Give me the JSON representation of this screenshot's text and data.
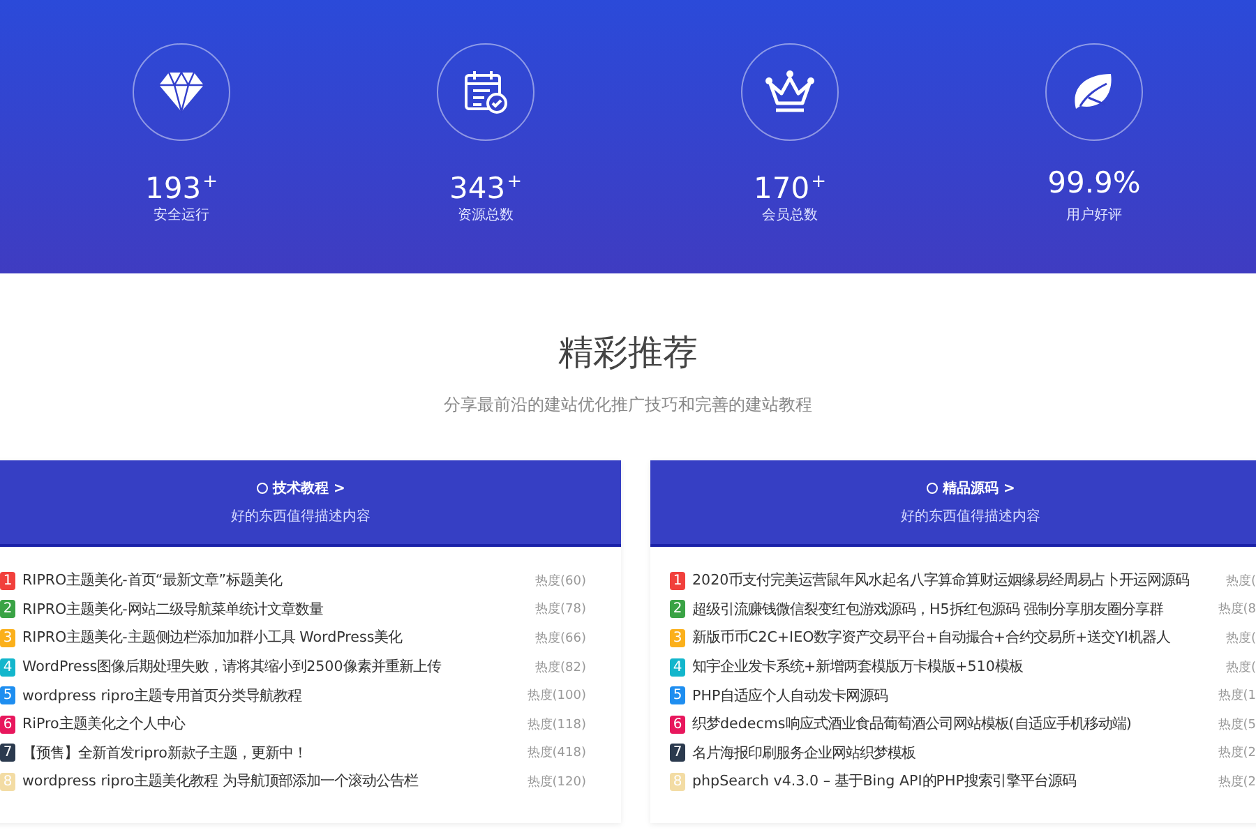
{
  "stats": [
    {
      "kind": "diamond",
      "value": "193",
      "sup": "+",
      "label": "安全运行"
    },
    {
      "kind": "calendar",
      "value": "343",
      "sup": "+",
      "label": "资源总数"
    },
    {
      "kind": "crown",
      "value": "170",
      "sup": "+",
      "label": "会员总数"
    },
    {
      "kind": "leaf",
      "value": "99.9%",
      "label": "用户好评"
    }
  ],
  "section": {
    "title": "精彩推荐",
    "subtitle": "分享最前沿的建站优化推广技巧和完善的建站教程"
  },
  "cards": [
    {
      "title": "技术教程 >",
      "subtitle": "好的东西值得描述内容",
      "items": [
        {
          "rank": "1",
          "color": "#f1403c",
          "title": "RIPRO主题美化-首页“最新文章”标题美化",
          "heat": "热度(60)"
        },
        {
          "rank": "2",
          "color": "#3aa345",
          "title": "RIPRO主题美化-网站二级导航菜单统计文章数量",
          "heat": "热度(78)"
        },
        {
          "rank": "3",
          "color": "#fbb01b",
          "title": "RIPRO主题美化-主题侧边栏添加加群小工具 WordPress美化",
          "heat": "热度(66)"
        },
        {
          "rank": "4",
          "color": "#13b6cc",
          "title": "WordPress图像后期处理失败，请将其缩小到2500像素并重新上传",
          "heat": "热度(82)"
        },
        {
          "rank": "5",
          "color": "#1e8ef0",
          "title": "wordpress ripro主题专用首页分类导航教程",
          "heat": "热度(100)"
        },
        {
          "rank": "6",
          "color": "#e8175d",
          "title": "RiPro主题美化之个人中心",
          "heat": "热度(118)"
        },
        {
          "rank": "7",
          "color": "#2b3a4e",
          "title": "【预售】全新首发ripro新款子主题，更新中！",
          "heat": "热度(418)"
        },
        {
          "rank": "8",
          "color": "#f3dca4",
          "title": "wordpress ripro主题美化教程 为导航顶部添加一个滚动公告栏",
          "heat": "热度(120)"
        }
      ]
    },
    {
      "title": "精品源码 >",
      "subtitle": "好的东西值得描述内容",
      "items": [
        {
          "rank": "1",
          "color": "#f1403c",
          "title": "2020币支付完美运营鼠年风水起名八字算命算财运姻缘易经周易占卜开运网源码",
          "heat": "热度("
        },
        {
          "rank": "2",
          "color": "#3aa345",
          "title": "超级引流赚钱微信裂变红包游戏源码，H5拆红包源码 强制分享朋友圈分享群",
          "heat": "热度(8"
        },
        {
          "rank": "3",
          "color": "#fbb01b",
          "title": "新版币币C2C+IEO数字资产交易平台+自动撮合+合约交易所+送交YI机器人",
          "heat": "热度("
        },
        {
          "rank": "4",
          "color": "#13b6cc",
          "title": "知宇企业发卡系统+新增两套模版万卡模版+510模板",
          "heat": "热度("
        },
        {
          "rank": "5",
          "color": "#1e8ef0",
          "title": "PHP自适应个人自动发卡网源码",
          "heat": "热度(1"
        },
        {
          "rank": "6",
          "color": "#e8175d",
          "title": "织梦dedecms响应式酒业食品葡萄酒公司网站模板(自适应手机移动端)",
          "heat": "热度(5"
        },
        {
          "rank": "7",
          "color": "#2b3a4e",
          "title": "名片海报印刷服务企业网站织梦模板",
          "heat": "热度(2"
        },
        {
          "rank": "8",
          "color": "#f3dca4",
          "title": "phpSearch v4.3.0 – 基于Bing API的PHP搜索引擎平台源码",
          "heat": "热度(2"
        }
      ]
    }
  ]
}
